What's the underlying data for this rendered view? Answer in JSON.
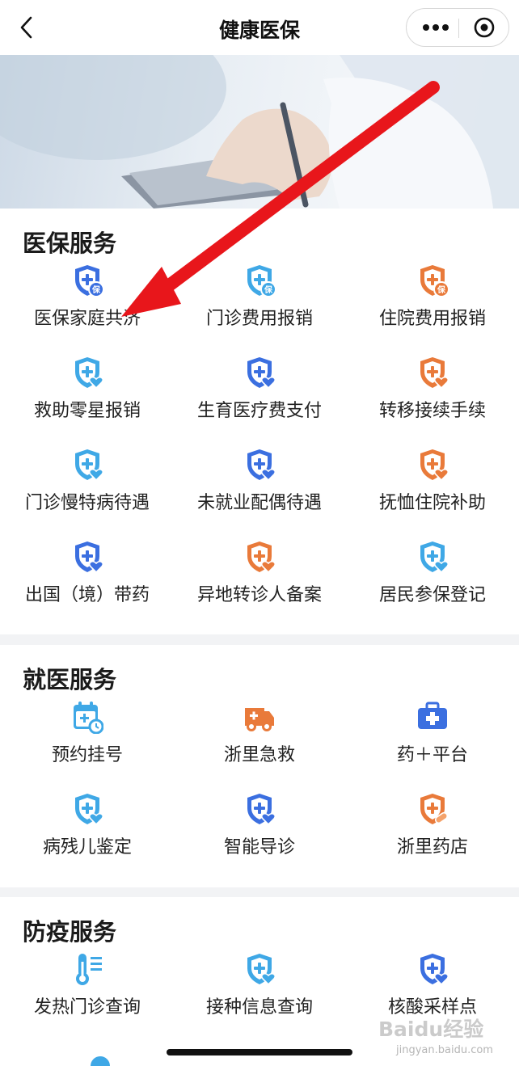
{
  "navbar": {
    "title": "健康医保"
  },
  "colors": {
    "blue": "#3b6fe0",
    "cyan": "#3fa8e6",
    "orange": "#e97a3a",
    "arrow": "#e8161b"
  },
  "sections": [
    {
      "title": "医保服务",
      "items": [
        {
          "label": "医保家庭共济",
          "icon": "shield-bao-icon",
          "color": "blue"
        },
        {
          "label": "门诊费用报销",
          "icon": "shield-bao-icon",
          "color": "cyan"
        },
        {
          "label": "住院费用报销",
          "icon": "shield-bao-icon",
          "color": "orange"
        },
        {
          "label": "救助零星报销",
          "icon": "shield-heart-icon",
          "color": "cyan"
        },
        {
          "label": "生育医疗费支付",
          "icon": "shield-heart-icon",
          "color": "blue"
        },
        {
          "label": "转移接续手续",
          "icon": "shield-heart-icon",
          "color": "orange"
        },
        {
          "label": "门诊慢特病待遇",
          "icon": "shield-heart-icon",
          "color": "cyan"
        },
        {
          "label": "未就业配偶待遇",
          "icon": "shield-heart-icon",
          "color": "blue"
        },
        {
          "label": "抚恤住院补助",
          "icon": "shield-heart-icon",
          "color": "orange"
        },
        {
          "label": "出国（境）带药",
          "icon": "shield-heart-icon",
          "color": "blue"
        },
        {
          "label": "异地转诊人备案",
          "icon": "shield-heart-icon",
          "color": "orange"
        },
        {
          "label": "居民参保登记",
          "icon": "shield-heart-icon",
          "color": "cyan"
        }
      ]
    },
    {
      "title": "就医服务",
      "items": [
        {
          "label": "预约挂号",
          "icon": "calendar-clock-icon",
          "color": "cyan"
        },
        {
          "label": "浙里急救",
          "icon": "ambulance-icon",
          "color": "orange"
        },
        {
          "label": "药＋平台",
          "icon": "medical-kit-icon",
          "color": "blue"
        },
        {
          "label": "病残儿鉴定",
          "icon": "shield-heart-icon",
          "color": "cyan"
        },
        {
          "label": "智能导诊",
          "icon": "shield-heart-icon",
          "color": "blue"
        },
        {
          "label": "浙里药店",
          "icon": "shield-pill-icon",
          "color": "orange"
        }
      ]
    },
    {
      "title": "防疫服务",
      "items": [
        {
          "label": "发热门诊查询",
          "icon": "thermometer-icon",
          "color": "cyan"
        },
        {
          "label": "接种信息查询",
          "icon": "shield-heart-icon",
          "color": "cyan"
        },
        {
          "label": "核酸采样点",
          "icon": "shield-heart-icon",
          "color": "blue"
        }
      ]
    }
  ],
  "watermark": {
    "logo": "Baidu经验",
    "url": "jingyan.baidu.com"
  }
}
